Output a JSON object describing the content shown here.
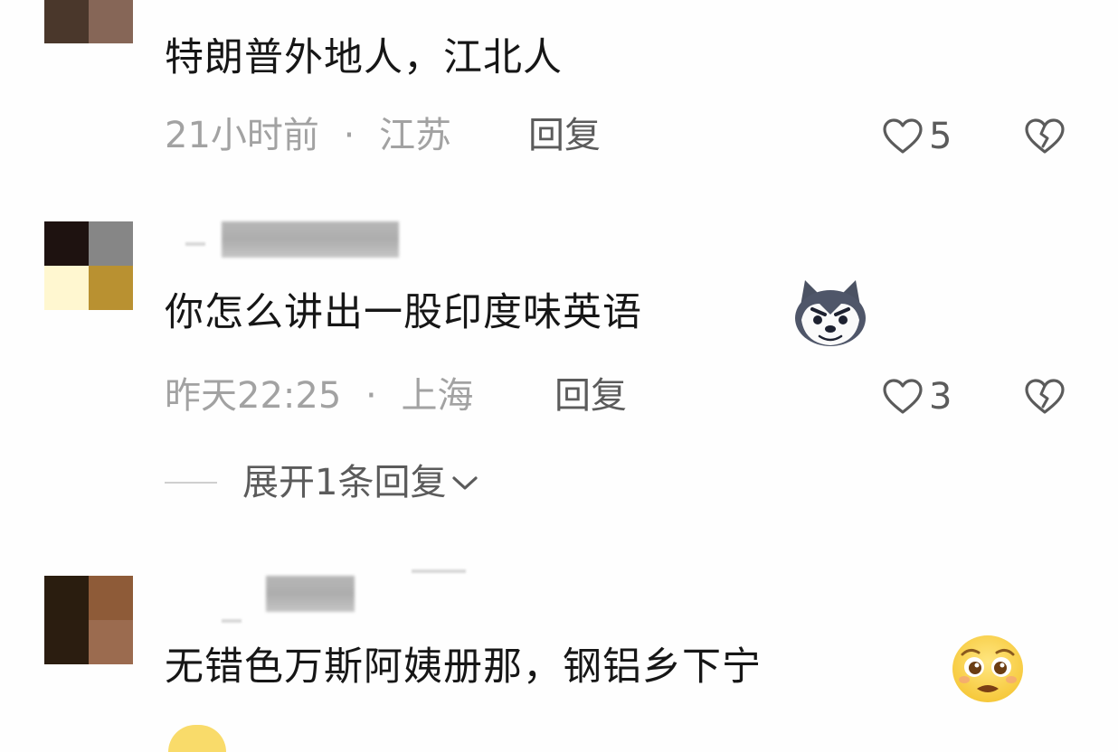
{
  "comments": [
    {
      "text": "特朗普外地人，江北人",
      "time": "21小时前",
      "location": "江苏",
      "reply_label": "回复",
      "likes": "5",
      "avatar_colors": [
        "#4a372b",
        "#866657",
        "#5a4236",
        "#957569"
      ]
    },
    {
      "text": "你怎么讲出一股印度味英语",
      "emoji": "husky-dog-emoji",
      "time": "昨天22:25",
      "location": "上海",
      "reply_label": "回复",
      "likes": "3",
      "expand_label": "展开1条回复",
      "avatar_colors": [
        "#1e1210",
        "#868686",
        "#fff7d0",
        "#b99131"
      ]
    },
    {
      "text": "无错色万斯阿姨册那，钢铝乡下宁",
      "emoji": "pleading-face-emoji",
      "avatar_colors": [
        "#2a1d0f",
        "#8e5b38",
        "#2b1d10",
        "#9b6b4f"
      ]
    }
  ],
  "separator": "·",
  "icons": {
    "like": "heart-outline-icon",
    "dislike": "broken-heart-icon",
    "expand": "chevron-down-icon"
  }
}
